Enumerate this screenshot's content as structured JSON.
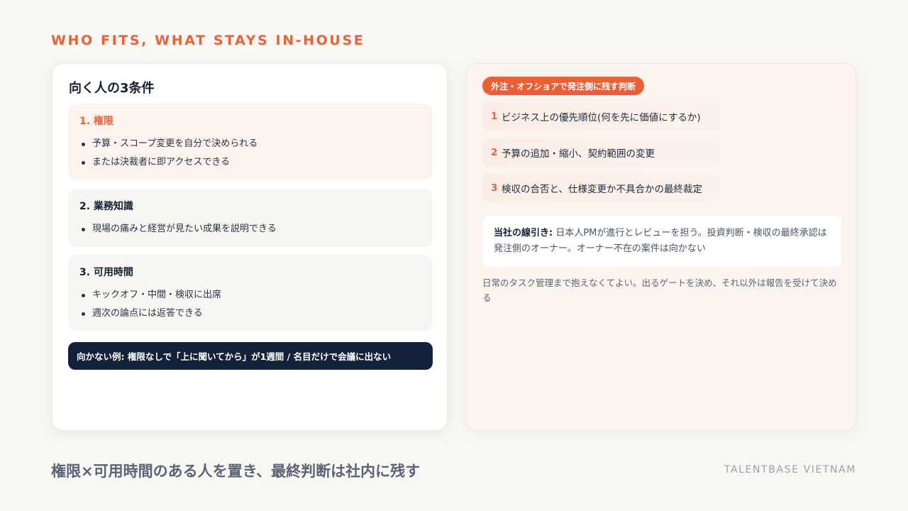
{
  "eyebrow": "WHO FITS, WHAT STAYS IN-HOUSE",
  "left_card": {
    "title": "向く人の3条件",
    "conditions": [
      {
        "heading": "1. 権限",
        "bullets": [
          "予算・スコープ変更を自分で決められる",
          "または決裁者に即アクセスできる"
        ]
      },
      {
        "heading": "2. 業務知識",
        "bullets": [
          "現場の痛みと経営が見たい成果を説明できる"
        ]
      },
      {
        "heading": "3. 可用時間",
        "bullets": [
          "キックオフ・中間・検収に出席",
          "週次の論点には返答できる"
        ]
      }
    ],
    "ng_example": "向かない例: 権限なしで「上に聞いてから」が1週間 / 名目だけで会議に出ない"
  },
  "right_card": {
    "pill": "外注・オフショアで発注側に残す判断",
    "judgments": [
      {
        "num": "1",
        "text": "ビジネス上の優先順位(何を先に価値にするか)"
      },
      {
        "num": "2",
        "text": "予算の追加・縮小、契約範囲の変更"
      },
      {
        "num": "3",
        "text": "検収の合否と、仕様変更か不具合かの最終裁定"
      }
    ],
    "policy_label": "当社の線引き:",
    "policy_text": " 日本人PMが進行とレビューを担う。投資判断・検収の最終承認は発注側のオーナー。オーナー不在の案件は向かない",
    "note": "日常のタスク管理まで抱えなくてよい。出るゲートを決め、それ以外は報告を受けて決める"
  },
  "footer": {
    "message": "権限×可用時間のある人を置き、最終判断は社内に残す",
    "brand": "TALENTBASE VIETNAM"
  },
  "colors": {
    "accent": "#e8633a",
    "navy": "#13223a",
    "background": "#f9f7f4"
  }
}
